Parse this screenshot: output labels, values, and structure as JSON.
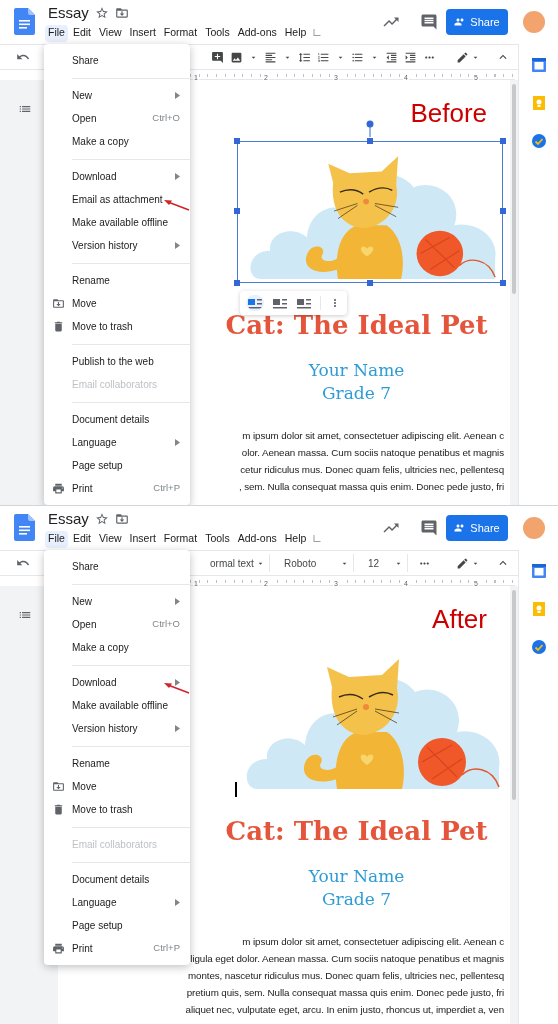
{
  "panels": [
    {
      "annotation": "Before",
      "header": {
        "title": "Essay",
        "share_label": "Share",
        "menu_bar": [
          {
            "label": "File",
            "selected": true
          },
          {
            "label": "Edit",
            "selected": false
          },
          {
            "label": "View",
            "selected": false
          },
          {
            "label": "Insert",
            "selected": false
          },
          {
            "label": "Format",
            "selected": false
          },
          {
            "label": "Tools",
            "selected": false
          },
          {
            "label": "Add-ons",
            "selected": false
          },
          {
            "label": "Help",
            "selected": false
          }
        ]
      },
      "toolbar": {
        "kind": "image-options"
      },
      "ruler": [
        "1",
        "2",
        "3",
        "4",
        "5"
      ],
      "file_menu": [
        {
          "items": [
            {
              "label": "Share",
              "kind": "plain",
              "submenu": false,
              "disabled": false,
              "pointed": false
            }
          ]
        },
        {
          "items": [
            {
              "label": "New",
              "kind": "plain",
              "submenu": true,
              "disabled": false,
              "pointed": false
            },
            {
              "label": "Open",
              "shortcut": "Ctrl+O",
              "kind": "plain",
              "submenu": false,
              "disabled": false,
              "pointed": false
            },
            {
              "label": "Make a copy",
              "kind": "plain",
              "submenu": false,
              "disabled": false,
              "pointed": false
            }
          ]
        },
        {
          "items": [
            {
              "label": "Download",
              "kind": "plain",
              "submenu": true,
              "disabled": false,
              "pointed": false
            },
            {
              "label": "Email as attachment",
              "kind": "plain",
              "submenu": false,
              "disabled": false,
              "pointed": true
            },
            {
              "label": "Make available offline",
              "kind": "plain",
              "submenu": false,
              "disabled": false,
              "pointed": false
            },
            {
              "label": "Version history",
              "kind": "plain",
              "submenu": true,
              "disabled": false,
              "pointed": false
            }
          ]
        },
        {
          "items": [
            {
              "label": "Rename",
              "kind": "plain",
              "submenu": false,
              "disabled": false,
              "pointed": false
            },
            {
              "label": "Move",
              "kind": "folder",
              "submenu": false,
              "disabled": false,
              "pointed": false
            },
            {
              "label": "Move to trash",
              "kind": "trash",
              "submenu": false,
              "disabled": false,
              "pointed": false
            }
          ]
        },
        {
          "items": [
            {
              "label": "Publish to the web",
              "kind": "plain",
              "submenu": false,
              "disabled": false,
              "pointed": false
            },
            {
              "label": "Email collaborators",
              "kind": "plain",
              "submenu": false,
              "disabled": true,
              "pointed": false
            }
          ]
        },
        {
          "items": [
            {
              "label": "Document details",
              "kind": "plain",
              "submenu": false,
              "disabled": false,
              "pointed": false
            },
            {
              "label": "Language",
              "kind": "plain",
              "submenu": true,
              "disabled": false,
              "pointed": false
            },
            {
              "label": "Page setup",
              "kind": "plain",
              "submenu": false,
              "disabled": false,
              "pointed": false
            },
            {
              "label": "Print",
              "shortcut": "Ctrl+P",
              "kind": "printer",
              "submenu": false,
              "disabled": false,
              "pointed": false
            }
          ]
        }
      ],
      "document": {
        "image": {
          "selected": true
        },
        "title": "Cat: The Ideal Pet",
        "author": "Your Name",
        "grade": "Grade 7",
        "body_lines": [
          "m ipsum dolor sit amet, consectetuer adipiscing elit. Aenean c",
          "olor. Aenean massa. Cum sociis natoque penatibus et magnis",
          "cetur ridiculus mus. Donec quam felis, ultricies nec, pellentesq",
          ", sem. Nulla consequat massa quis enim. Donec pede justo, fri"
        ]
      }
    },
    {
      "annotation": "After",
      "header": {
        "title": "Essay",
        "share_label": "Share",
        "menu_bar": [
          {
            "label": "File",
            "selected": true
          },
          {
            "label": "Edit",
            "selected": false
          },
          {
            "label": "View",
            "selected": false
          },
          {
            "label": "Insert",
            "selected": false
          },
          {
            "label": "Format",
            "selected": false
          },
          {
            "label": "Tools",
            "selected": false
          },
          {
            "label": "Add-ons",
            "selected": false
          },
          {
            "label": "Help",
            "selected": false
          }
        ]
      },
      "toolbar": {
        "kind": "text-options",
        "style": "ormal text",
        "font": "Roboto",
        "size": "12"
      },
      "ruler": [
        "1",
        "2",
        "3",
        "4",
        "5"
      ],
      "file_menu": [
        {
          "items": [
            {
              "label": "Share",
              "kind": "plain",
              "submenu": false,
              "disabled": false,
              "pointed": false
            }
          ]
        },
        {
          "items": [
            {
              "label": "New",
              "kind": "plain",
              "submenu": true,
              "disabled": false,
              "pointed": false
            },
            {
              "label": "Open",
              "shortcut": "Ctrl+O",
              "kind": "plain",
              "submenu": false,
              "disabled": false,
              "pointed": false
            },
            {
              "label": "Make a copy",
              "kind": "plain",
              "submenu": false,
              "disabled": false,
              "pointed": false
            }
          ]
        },
        {
          "items": [
            {
              "label": "Download",
              "kind": "plain",
              "submenu": true,
              "disabled": false,
              "pointed": true
            },
            {
              "label": "Make available offline",
              "kind": "plain",
              "submenu": false,
              "disabled": false,
              "pointed": false
            },
            {
              "label": "Version history",
              "kind": "plain",
              "submenu": true,
              "disabled": false,
              "pointed": false
            }
          ]
        },
        {
          "items": [
            {
              "label": "Rename",
              "kind": "plain",
              "submenu": false,
              "disabled": false,
              "pointed": false
            },
            {
              "label": "Move",
              "kind": "folder",
              "submenu": false,
              "disabled": false,
              "pointed": false
            },
            {
              "label": "Move to trash",
              "kind": "trash",
              "submenu": false,
              "disabled": false,
              "pointed": false
            }
          ]
        },
        {
          "items": [
            {
              "label": "Email collaborators",
              "kind": "plain",
              "submenu": false,
              "disabled": true,
              "pointed": false
            }
          ]
        },
        {
          "items": [
            {
              "label": "Document details",
              "kind": "plain",
              "submenu": false,
              "disabled": false,
              "pointed": false
            },
            {
              "label": "Language",
              "kind": "plain",
              "submenu": true,
              "disabled": false,
              "pointed": false
            },
            {
              "label": "Page setup",
              "kind": "plain",
              "submenu": false,
              "disabled": false,
              "pointed": false
            },
            {
              "label": "Print",
              "shortcut": "Ctrl+P",
              "kind": "printer",
              "submenu": false,
              "disabled": false,
              "pointed": false
            }
          ]
        }
      ],
      "document": {
        "image": {
          "selected": false
        },
        "title": "Cat: The Ideal Pet",
        "author": "Your Name",
        "grade": "Grade 7",
        "body_lines": [
          "m ipsum dolor sit amet, consectetuer adipiscing elit. Aenean c",
          "ligula eget dolor. Aenean massa. Cum sociis natoque penatibus et magnis",
          "montes, nascetur ridiculus mus. Donec quam felis, ultricies nec, pellentesq",
          "pretium quis, sem. Nulla consequat massa quis enim. Donec pede justo, fri",
          "aliquet nec, vulputate eget, arcu. In enim justo, rhoncus ut, imperdiet a, ven"
        ]
      }
    }
  ]
}
